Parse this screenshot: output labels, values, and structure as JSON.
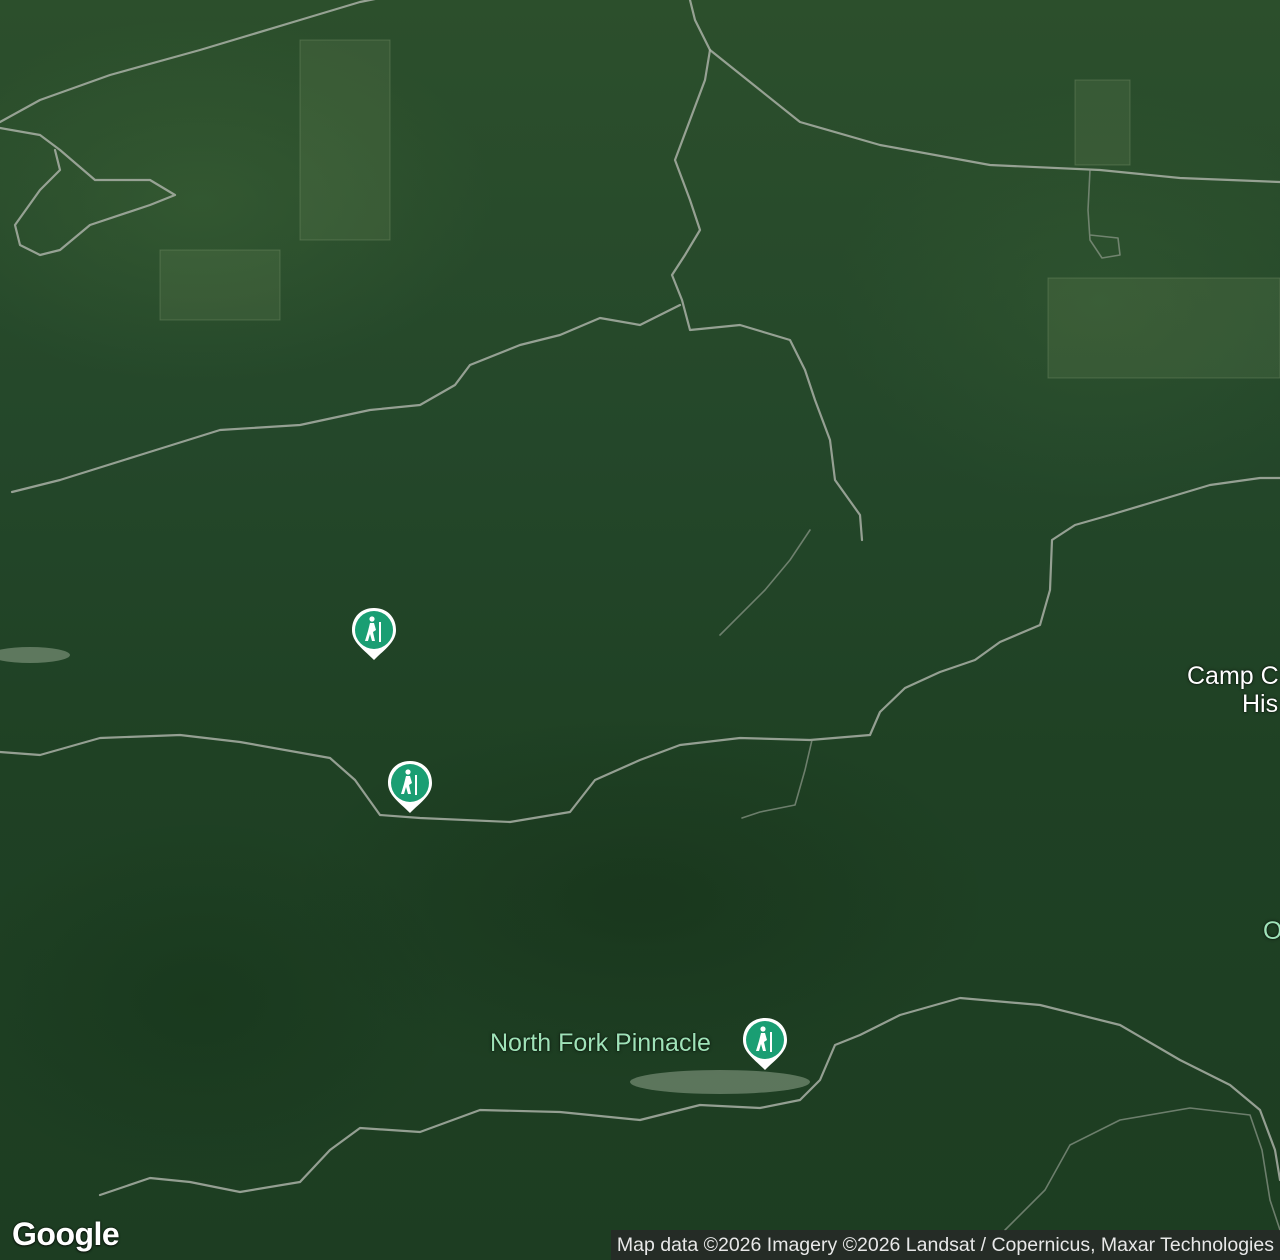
{
  "map": {
    "type": "satellite",
    "accent_pin_color": "#1a9e73",
    "pins": [
      {
        "icon": "hiking-icon",
        "label": ""
      },
      {
        "icon": "hiking-icon",
        "label": ""
      },
      {
        "icon": "hiking-icon",
        "label": "North Fork Pinnacle"
      }
    ],
    "labels": {
      "north_fork": "North Fork Pinnacle",
      "camp_line1": "Camp C",
      "camp_line2": "His",
      "partial_o": "O"
    },
    "logo": "Google",
    "attribution": "Map data ©2026 Imagery ©2026 Landsat / Copernicus, Maxar Technologies"
  }
}
